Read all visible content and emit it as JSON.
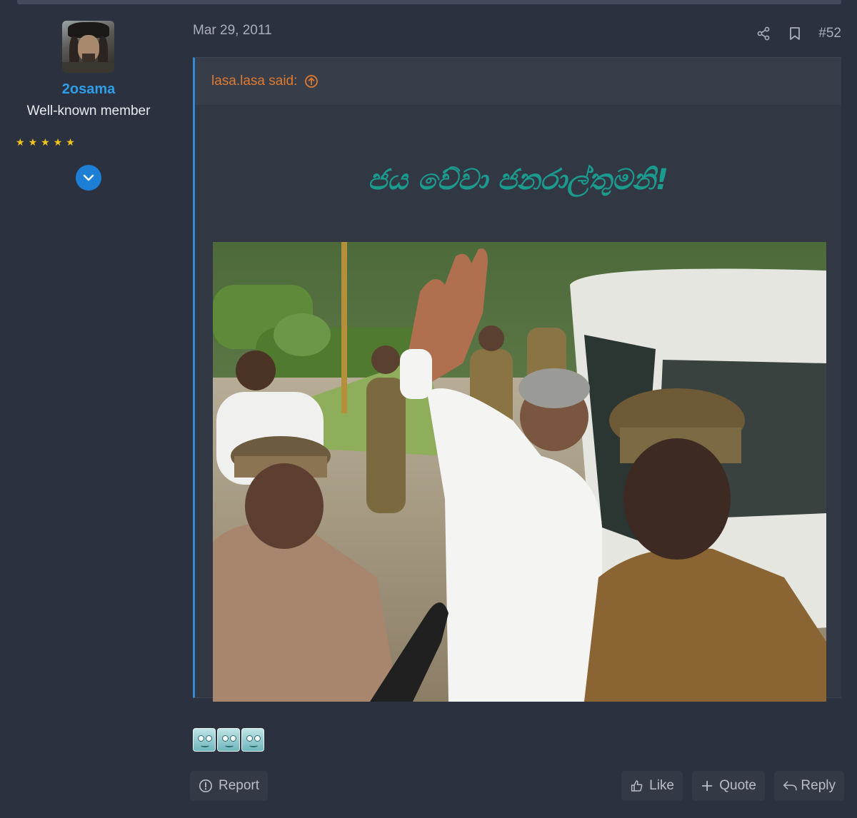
{
  "user": {
    "name": "2osama",
    "title": "Well-known member",
    "rating_stars": 5
  },
  "post": {
    "date": "Mar 29, 2011",
    "number": "#52"
  },
  "quote": {
    "author_label": "lasa.lasa said:",
    "headline": "ජය වේවා ජනරාල්තුමනි!"
  },
  "actions": {
    "report": "Report",
    "like": "Like",
    "quote": "Quote",
    "reply": "Reply"
  },
  "icons": {
    "share": "share-icon",
    "bookmark": "bookmark-icon",
    "expand": "chevron-down-icon",
    "jump": "arrow-up-circle-icon"
  },
  "colors": {
    "background": "#2c3140",
    "username": "#2f9ee8",
    "quote_author": "#e07a2e",
    "quote_border": "#2f8ad6",
    "headline": "#1a9b8e",
    "stars": "#f2c318"
  }
}
